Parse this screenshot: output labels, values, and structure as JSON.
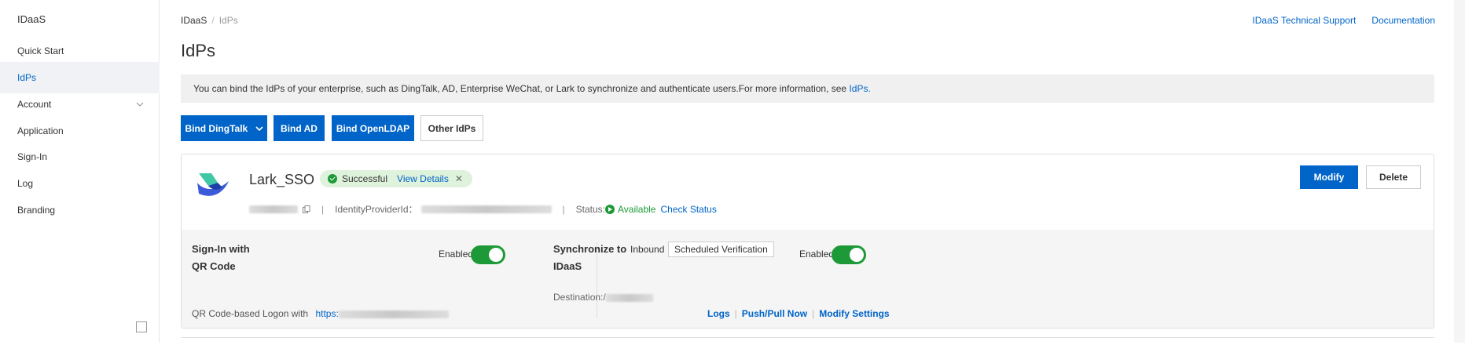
{
  "sidebar": {
    "brand": "IDaaS",
    "items": [
      {
        "label": "Quick Start"
      },
      {
        "label": "IdPs"
      },
      {
        "label": "Account"
      },
      {
        "label": "Application"
      },
      {
        "label": "Sign-In"
      },
      {
        "label": "Log"
      },
      {
        "label": "Branding"
      }
    ]
  },
  "breadcrumb": {
    "root": "IDaaS",
    "current": "IdPs"
  },
  "toplinks": {
    "support": "IDaaS Technical Support",
    "docs": "Documentation"
  },
  "page": {
    "title": "IdPs"
  },
  "notice": {
    "text": "You can bind the IdPs of your enterprise, such as DingTalk, AD, Enterprise WeChat, or Lark to synchronize and authenticate users.For more information, see ",
    "link": "IdPs."
  },
  "actions": {
    "bind_dingtalk": "Bind DingTalk",
    "bind_ad": "Bind AD",
    "bind_openldap": "Bind OpenLDAP",
    "other_idps": "Other IdPs"
  },
  "idp": {
    "name": "Lark_SSO",
    "badge_status": "Successful",
    "badge_link": "View Details",
    "id_label": "IdentityProviderId：",
    "status_label": "Status:",
    "status_value": "Available",
    "check_status": "Check Status",
    "modify": "Modify",
    "delete": "Delete",
    "signin": {
      "title_line1": "Sign-In with",
      "title_line2": "QR Code",
      "enabled_label": "Enabled",
      "enabled": true,
      "logon_label": "QR Code-based Logon with",
      "logon_link_prefix": "https:"
    },
    "sync": {
      "title_line1": "Synchronize to",
      "title_line2": "IDaaS",
      "direction": "Inbound",
      "tag": "Scheduled Verification",
      "enabled_label": "Enabled",
      "enabled": true,
      "destination_label": "Destination:/",
      "links": [
        "Logs",
        "Push/Pull Now",
        "Modify Settings"
      ]
    }
  }
}
